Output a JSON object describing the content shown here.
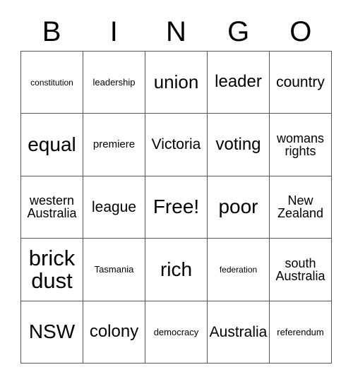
{
  "card": {
    "title": "BINGO",
    "header_letters": [
      "B",
      "I",
      "N",
      "G",
      "O"
    ],
    "free_space_label": "Free!",
    "rows": [
      [
        {
          "text": "constitution",
          "size": "tiny"
        },
        {
          "text": "leadership",
          "size": "xxs"
        },
        {
          "text": "union",
          "size": "lg"
        },
        {
          "text": "leader",
          "size": "ml"
        },
        {
          "text": "country",
          "size": "md"
        }
      ],
      [
        {
          "text": "equal",
          "size": "xl"
        },
        {
          "text": "premiere",
          "size": "xs"
        },
        {
          "text": "Victoria",
          "size": "md"
        },
        {
          "text": "voting",
          "size": "ml"
        },
        {
          "text": "womans rights",
          "size": "sm"
        }
      ],
      [
        {
          "text": "western Australia",
          "size": "sm"
        },
        {
          "text": "league",
          "size": "md"
        },
        {
          "text": "Free!",
          "size": "xl"
        },
        {
          "text": "poor",
          "size": "xl"
        },
        {
          "text": "New Zealand",
          "size": "sm"
        }
      ],
      [
        {
          "text": "brick dust",
          "size": "xxl"
        },
        {
          "text": "Tasmania",
          "size": "xxs"
        },
        {
          "text": "rich",
          "size": "xl"
        },
        {
          "text": "federation",
          "size": "tiny"
        },
        {
          "text": "south Australia",
          "size": "sm"
        }
      ],
      [
        {
          "text": "NSW",
          "size": "xl"
        },
        {
          "text": "colony",
          "size": "ml"
        },
        {
          "text": "democracy",
          "size": "xxs"
        },
        {
          "text": "Australia",
          "size": "md"
        },
        {
          "text": "referendum",
          "size": "xxs"
        }
      ]
    ]
  },
  "colors": {
    "background": "#ffffff",
    "text": "#000000",
    "border": "#555555"
  }
}
